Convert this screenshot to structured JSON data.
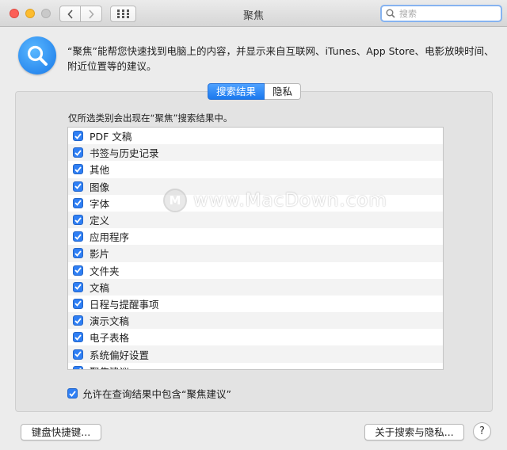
{
  "window": {
    "title": "聚焦"
  },
  "search": {
    "placeholder": "搜索"
  },
  "header": {
    "description": "“聚焦”能帮您快速找到电脑上的内容，并显示来自互联网、iTunes、App Store、电影放映时间、附近位置等的建议。"
  },
  "tabs": [
    {
      "label": "搜索结果",
      "active": true
    },
    {
      "label": "隐私",
      "active": false
    }
  ],
  "panel": {
    "caption": "仅所选类别会出现在“聚焦”搜索结果中。",
    "categories": [
      {
        "label": "PDF 文稿",
        "checked": true
      },
      {
        "label": "书签与历史记录",
        "checked": true
      },
      {
        "label": "其他",
        "checked": true
      },
      {
        "label": "图像",
        "checked": true
      },
      {
        "label": "字体",
        "checked": true
      },
      {
        "label": "定义",
        "checked": true
      },
      {
        "label": "应用程序",
        "checked": true
      },
      {
        "label": "影片",
        "checked": true
      },
      {
        "label": "文件夹",
        "checked": true
      },
      {
        "label": "文稿",
        "checked": true
      },
      {
        "label": "日程与提醒事项",
        "checked": true
      },
      {
        "label": "演示文稿",
        "checked": true
      },
      {
        "label": "电子表格",
        "checked": true
      },
      {
        "label": "系统偏好设置",
        "checked": true
      },
      {
        "label": "聚焦建议",
        "checked": true
      }
    ],
    "allow_suggestions": {
      "label": "允许在查询结果中包含“聚焦建议”",
      "checked": true
    }
  },
  "buttons": {
    "keyboard_shortcuts": "键盘快捷键...",
    "about_privacy": "关于搜索与隐私...",
    "help": "?"
  },
  "watermark": {
    "text": "www.MacDown.com",
    "logo": "M"
  },
  "colors": {
    "accent": "#2f7ff4",
    "close": "#fc5f57",
    "minimize": "#fdbc2e",
    "zoom": "#c9c9c9"
  }
}
